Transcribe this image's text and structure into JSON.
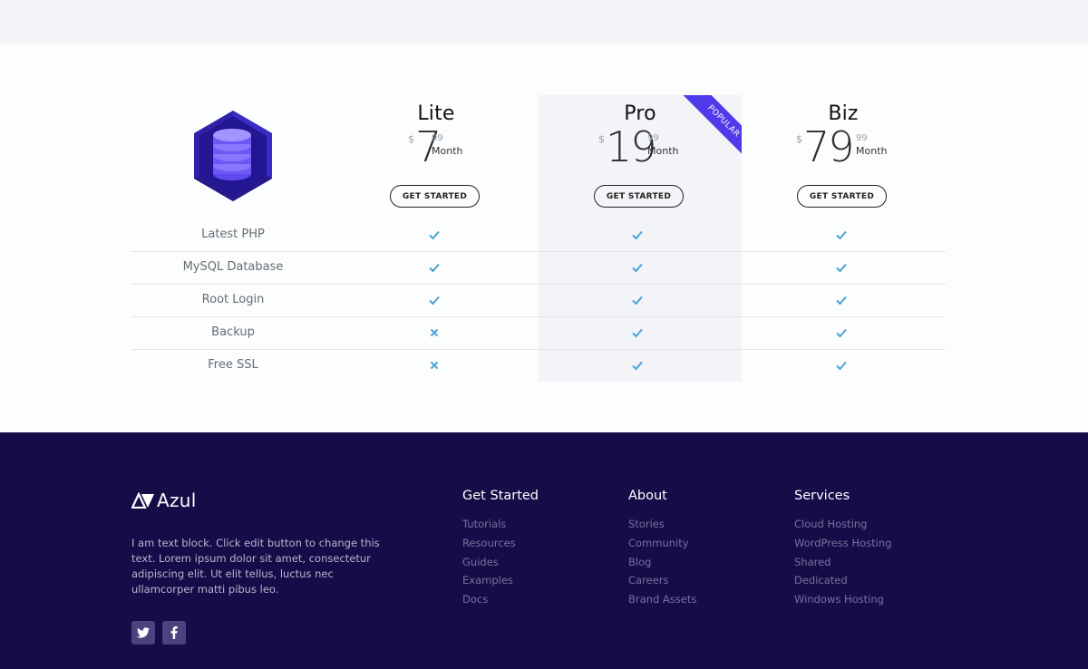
{
  "plans": [
    {
      "name": "Lite",
      "currency": "$",
      "amount": "7",
      "cents": "99",
      "period": "Month",
      "cta": "GET STARTED",
      "popular": false
    },
    {
      "name": "Pro",
      "currency": "$",
      "amount": "19",
      "cents": "99",
      "period": "Month",
      "cta": "GET STARTED",
      "popular": true
    },
    {
      "name": "Biz",
      "currency": "$",
      "amount": "79",
      "cents": "99",
      "period": "Month",
      "cta": "GET STARTED",
      "popular": false
    }
  ],
  "ribbon_label": "POPULAR",
  "features": [
    {
      "label": "Latest PHP",
      "lite": "check",
      "pro": "check",
      "biz": "check"
    },
    {
      "label": "MySQL Database",
      "lite": "check",
      "pro": "check",
      "biz": "check"
    },
    {
      "label": "Root Login",
      "lite": "check",
      "pro": "check",
      "biz": "check"
    },
    {
      "label": "Backup",
      "lite": "cross",
      "pro": "check",
      "biz": "check"
    },
    {
      "label": "Free SSL",
      "lite": "cross",
      "pro": "check",
      "biz": "check"
    }
  ],
  "icons": {
    "check": "check-icon",
    "cross": "cross-icon",
    "logo": "database-hexagon-icon"
  },
  "colors": {
    "accent": "#4f3bea",
    "check": "#4aa3d6",
    "footer_bg": "#150d48"
  },
  "footer": {
    "brand": "Azul",
    "about": "I am text block. Click edit button to change this text. Lorem ipsum dolor sit amet, consectetur adipiscing elit. Ut elit tellus, luctus nec ullamcorper matti pibus leo.",
    "columns": [
      {
        "title": "Get Started",
        "links": [
          "Tutorials",
          "Resources",
          "Guides",
          "Examples",
          "Docs"
        ]
      },
      {
        "title": "About",
        "links": [
          "Stories",
          "Community",
          "Blog",
          "Careers",
          "Brand Assets"
        ]
      },
      {
        "title": "Services",
        "links": [
          "Cloud Hosting",
          "WordPress Hosting",
          "Shared",
          "Dedicated",
          "Windows Hosting"
        ]
      }
    ],
    "social": [
      "twitter-icon",
      "facebook-icon"
    ]
  }
}
